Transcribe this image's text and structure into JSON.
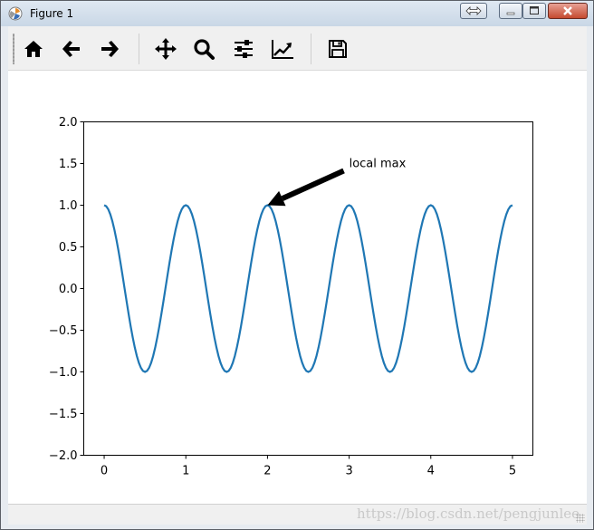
{
  "window": {
    "title": "Figure 1"
  },
  "toolbar": {
    "tools": [
      {
        "name": "home",
        "icon": "home-icon"
      },
      {
        "name": "back",
        "icon": "arrow-left-icon"
      },
      {
        "name": "forward",
        "icon": "arrow-right-icon"
      },
      {
        "name": "pan",
        "icon": "move-icon"
      },
      {
        "name": "zoom",
        "icon": "magnifier-icon"
      },
      {
        "name": "subplots",
        "icon": "sliders-icon"
      },
      {
        "name": "edit-axes",
        "icon": "line-chart-icon"
      },
      {
        "name": "save",
        "icon": "floppy-disk-icon"
      }
    ]
  },
  "status": {
    "watermark": "https://blog.csdn.net/pengjunlee"
  },
  "chart_data": {
    "type": "line",
    "title": "",
    "xlabel": "",
    "ylabel": "",
    "xlim": [
      -0.25,
      5.25
    ],
    "ylim": [
      -2.0,
      2.0
    ],
    "x_ticks": [
      "0",
      "1",
      "2",
      "3",
      "4",
      "5"
    ],
    "y_ticks": [
      "2.0",
      "1.5",
      "1.0",
      "0.5",
      "0.0",
      "−0.5",
      "−1.0",
      "−1.5",
      "−2.0"
    ],
    "x_tick_values": [
      0,
      1,
      2,
      3,
      4,
      5
    ],
    "y_tick_values": [
      2.0,
      1.5,
      1.0,
      0.5,
      0.0,
      -0.5,
      -1.0,
      -1.5,
      -2.0
    ],
    "series": [
      {
        "function": "cos(2*pi*x)",
        "x_range": [
          0,
          5
        ],
        "samples": 200,
        "color": "#1f77b4"
      }
    ],
    "grid": false,
    "annotation": {
      "text": "local max",
      "xy": [
        2,
        1
      ],
      "xytext": [
        3,
        1.5
      ],
      "arrow_color": "#000000"
    }
  }
}
